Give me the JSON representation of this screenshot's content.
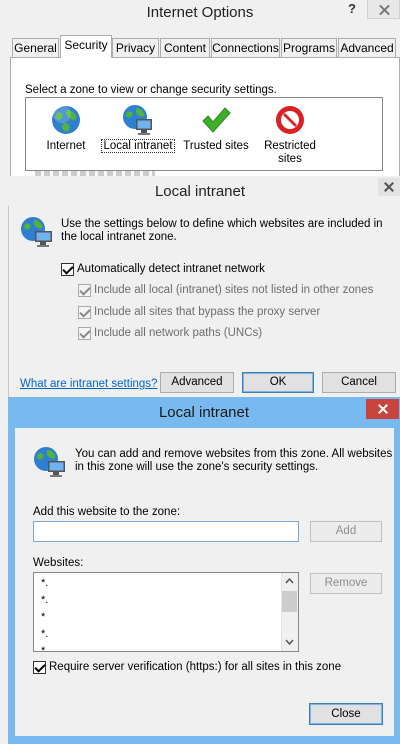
{
  "internet_options": {
    "title": "Internet Options",
    "help": "?",
    "tabs": [
      "General",
      "Security",
      "Privacy",
      "Content",
      "Connections",
      "Programs",
      "Advanced"
    ],
    "active_tab": "Security",
    "zone_instruction": "Select a zone to view or change security settings.",
    "zones": [
      {
        "label": "Internet",
        "icon": "globe-icon"
      },
      {
        "label": "Local intranet",
        "icon": "intranet-icon",
        "selected": true
      },
      {
        "label": "Trusted sites",
        "icon": "check-icon"
      },
      {
        "label": "Restricted sites",
        "icon": "restricted-icon"
      }
    ]
  },
  "intranet_settings": {
    "title": "Local intranet",
    "description": "Use the settings below to define which websites are included in the local intranet zone.",
    "auto_detect_label": "Automatically detect intranet network",
    "option_local_sites": "Include all local (intranet) sites not listed in other zones",
    "option_bypass_proxy": "Include all sites that bypass the proxy server",
    "option_network_paths": "Include all network paths (UNCs)",
    "link_text": "What are intranet settings?",
    "advanced_label": "Advanced",
    "ok_label": "OK",
    "cancel_label": "Cancel"
  },
  "intranet_sites": {
    "title": "Local intranet",
    "description": "You can add and remove websites from this zone. All websites in this zone will use the zone's security settings.",
    "add_label": "Add this website to the zone:",
    "add_input_value": "",
    "add_button": "Add",
    "websites_label": "Websites:",
    "websites": [
      "*.",
      "*.",
      "*",
      "*.",
      "*."
    ],
    "remove_button": "Remove",
    "require_verification_label": "Require server verification (https:) for all sites in this zone",
    "close_button": "Close"
  },
  "colors": {
    "dialog_frame": "#78b9ef",
    "close_button": "#c7453e",
    "link": "#0066cc"
  }
}
